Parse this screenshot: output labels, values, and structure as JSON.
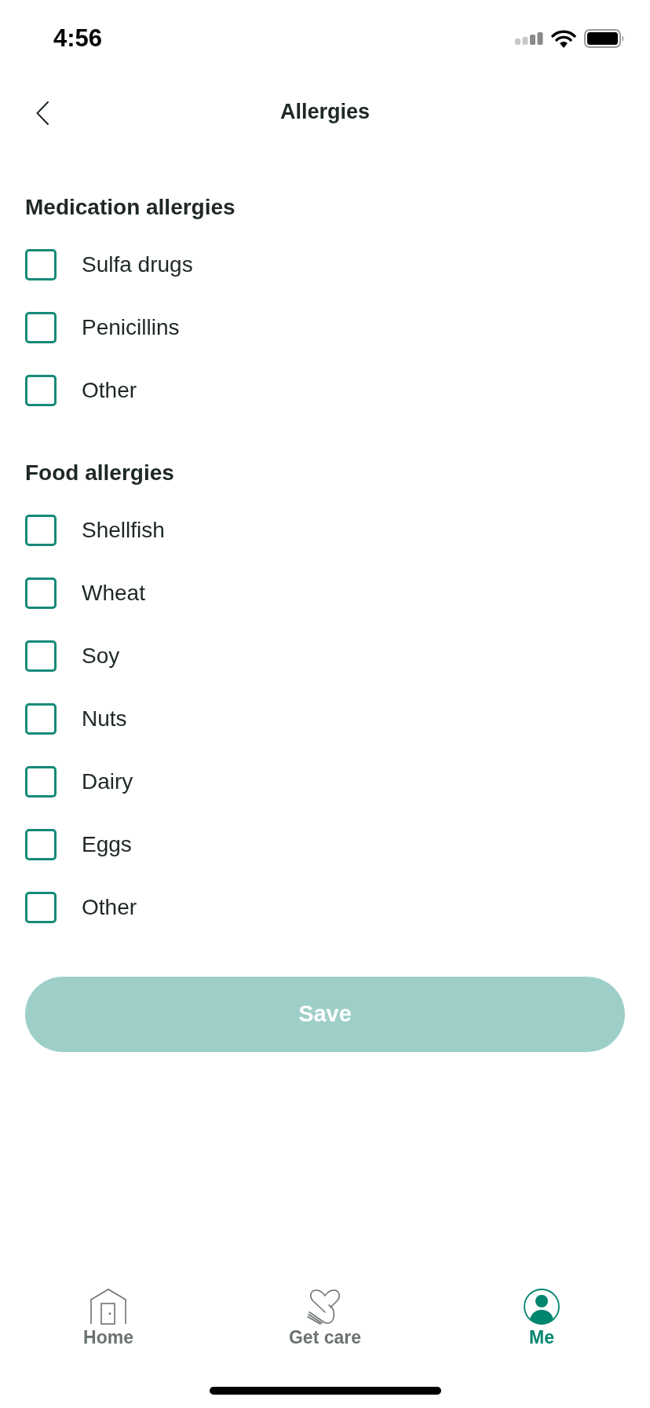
{
  "status_bar": {
    "time": "4:56"
  },
  "header": {
    "title": "Allergies"
  },
  "sections": [
    {
      "heading": "Medication allergies",
      "options": [
        {
          "label": "Sulfa drugs",
          "checked": false
        },
        {
          "label": "Penicillins",
          "checked": false
        },
        {
          "label": "Other",
          "checked": false
        }
      ]
    },
    {
      "heading": "Food allergies",
      "options": [
        {
          "label": "Shellfish",
          "checked": false
        },
        {
          "label": "Wheat",
          "checked": false
        },
        {
          "label": "Soy",
          "checked": false
        },
        {
          "label": "Nuts",
          "checked": false
        },
        {
          "label": "Dairy",
          "checked": false
        },
        {
          "label": "Eggs",
          "checked": false
        },
        {
          "label": "Other",
          "checked": false
        }
      ]
    }
  ],
  "save_button": {
    "label": "Save",
    "disabled": true
  },
  "tab_bar": [
    {
      "label": "Home",
      "kind": "home",
      "selected": false
    },
    {
      "label": "Get care",
      "kind": "care",
      "selected": false
    },
    {
      "label": "Me",
      "kind": "profile",
      "selected": true
    }
  ]
}
